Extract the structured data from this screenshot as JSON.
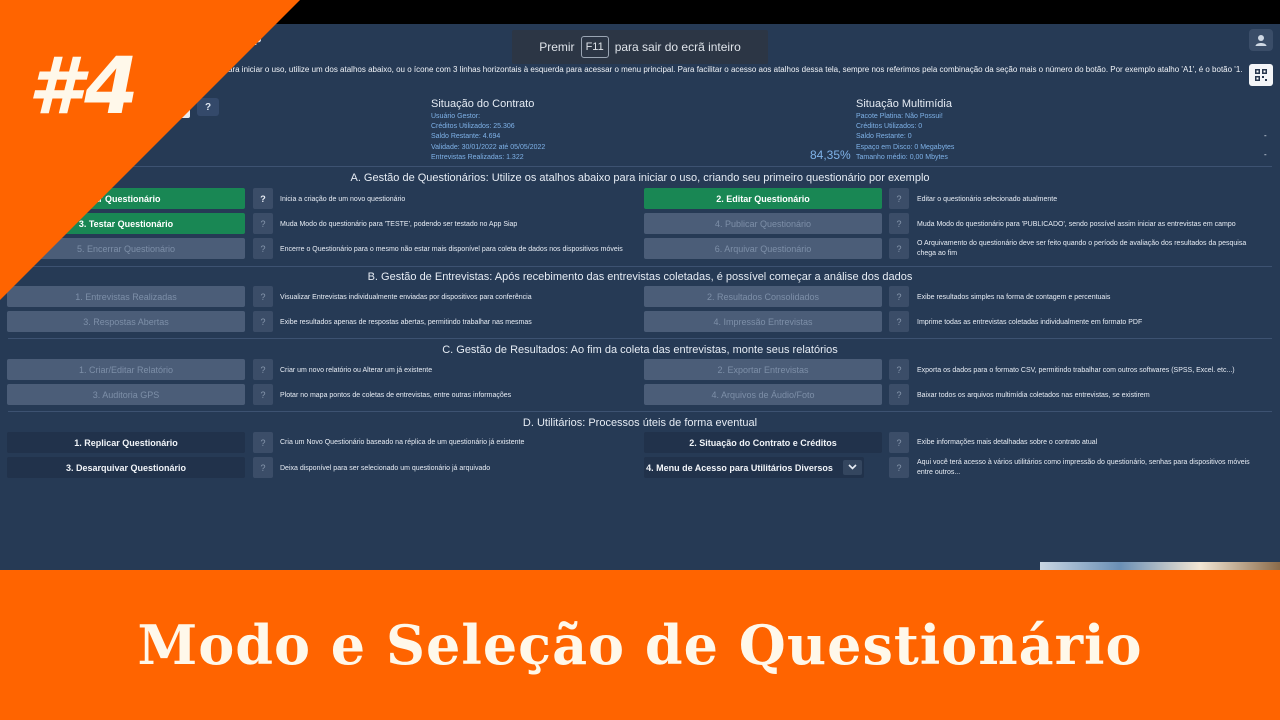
{
  "app": {
    "title": "P",
    "intro": "ara iniciar o uso, utilize um dos atalhos abaixo, ou o ícone com 3 linhas horizontais à esquerda para acessar o menu principal. Para facilitar o acesso aos atalhos dessa tela, sempre nos referimos pela combinação da seção mais o número do botão. Por exemplo atalho 'A1', é o botão '1.",
    "help_symbol": "?"
  },
  "fullscreen_hint": {
    "prefix": "Premir",
    "key": "F11",
    "suffix": "para sair do ecrã inteiro"
  },
  "contrato": {
    "title": "Situação do Contrato",
    "lines": [
      "Usuário Gestor:",
      "Créditos Utilizados: 25.306",
      "Saldo Restante: 4.694",
      "Validade: 30/01/2022 até 05/05/2022",
      "Entrevistas Realizadas: 1.322"
    ],
    "percent": "84,35%"
  },
  "multimidia": {
    "title": "Situação Multimídia",
    "lines": [
      "Pacote Platina: Não Possui!",
      "Créditos Utilizados: 0",
      "Saldo Restante: 0",
      "Espaço em Disco: 0 Megabytes",
      "Tamanho médio: 0,00 Mbytes"
    ],
    "dash": "-"
  },
  "sections": {
    "a": "A. Gestão de Questionários: Utilize os atalhos abaixo para iniciar o uso, criando seu primeiro questionário por exemplo",
    "b": "B. Gestão de Entrevistas: Após recebimento das entrevistas coletadas, é possível começar a análise dos dados",
    "c": "C. Gestão de Resultados: Ao fim da coleta das entrevistas, monte seus relatórios",
    "d": "D. Utilitários: Processos úteis de forma eventual"
  },
  "buttons": {
    "a1": "iar Questionário",
    "a1_desc": "Inicia a criação de um novo questionário",
    "a2": "2. Editar Questionário",
    "a2_desc": "Editar o questionário selecionado atualmente",
    "a3": "3. Testar Questionário",
    "a3_desc": "Muda Modo do questionário para 'TESTE', podendo ser testado no App Siap",
    "a4": "4. Publicar Questionário",
    "a4_desc": "Muda Modo do questionário para 'PUBLICADO', sendo possível assim iniciar as entrevistas em campo",
    "a5": "5. Encerrar Questionário",
    "a5_desc": "Encerre o Questionário para o mesmo não estar mais disponível para coleta de dados nos dispositivos móveis",
    "a6": "6. Arquivar Questionário",
    "a6_desc": "O Arquivamento do questionário deve ser feito quando o período de avaliação dos resultados da pesquisa chega ao fim",
    "b1": "1. Entrevistas Realizadas",
    "b1_desc": "Visualizar Entrevistas individualmente enviadas por dispositivos para conferência",
    "b2": "2. Resultados Consolidados",
    "b2_desc": "Exibe resultados simples na forma de contagem e percentuais",
    "b3": "3. Respostas Abertas",
    "b3_desc": "Exibe resultados apenas de respostas abertas, permitindo trabalhar nas mesmas",
    "b4": "4. Impressão Entrevistas",
    "b4_desc": "Imprime todas as entrevistas coletadas individualmente em formato PDF",
    "c1": "1. Criar/Editar Relatório",
    "c1_desc": "Criar um novo relatório ou Alterar um já existente",
    "c2": "2. Exportar Entrevistas",
    "c2_desc": "Exporta os dados para o formato CSV, permitindo trabalhar com outros softwares (SPSS, Excel. etc...)",
    "c3": "3. Auditoria GPS",
    "c3_desc": "Plotar no mapa pontos de coletas de entrevistas, entre outras informações",
    "c4": "4. Arquivos de Áudio/Foto",
    "c4_desc": "Baixar todos os arquivos multimídia coletados nas entrevistas, se existirem",
    "d1": "1. Replicar Questionário",
    "d1_desc": "Cria um Novo Questionário baseado na réplica de um questionário já existente",
    "d2": "2. Situação do Contrato e Créditos",
    "d2_desc": "Exibe informações mais detalhadas sobre o contrato atual",
    "d3": "3. Desarquivar Questionário",
    "d3_desc": "Deixa disponível para ser selecionado um questionário já arquivado",
    "d4": "4. Menu de Acesso para Utilitários Diversos",
    "d4_desc": "Aqui você terá acesso à vários utilitários como impressão do questionário, senhas para dispositivos móveis entre outros..."
  },
  "overlay": {
    "episode": "#4",
    "banner": "Modo e Seleção de Questionário",
    "accent": "#ff6400"
  }
}
